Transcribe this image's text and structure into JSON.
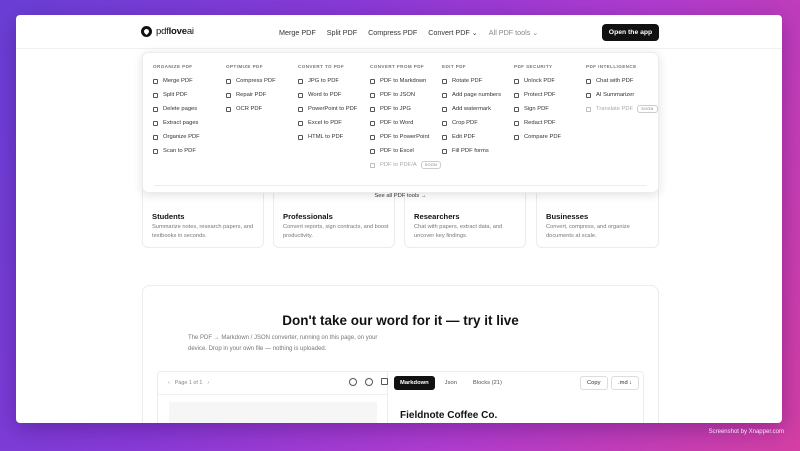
{
  "header": {
    "logo_text": "pdf",
    "logo_bold": "love",
    "logo_suffix": "ai",
    "menu": [
      "Merge PDF",
      "Split PDF",
      "Compress PDF",
      "Convert PDF ⌄",
      "All PDF tools ⌄"
    ],
    "open_app": "Open the app"
  },
  "dropdown": {
    "columns": [
      {
        "title": "ORGANIZE PDF",
        "items": [
          {
            "label": "Merge PDF"
          },
          {
            "label": "Split PDF"
          },
          {
            "label": "Delete pages"
          },
          {
            "label": "Extract pages"
          },
          {
            "label": "Organize PDF"
          },
          {
            "label": "Scan to PDF"
          }
        ]
      },
      {
        "title": "OPTIMIZE PDF",
        "items": [
          {
            "label": "Compress PDF"
          },
          {
            "label": "Repair PDF"
          },
          {
            "label": "OCR PDF"
          }
        ]
      },
      {
        "title": "CONVERT TO PDF",
        "items": [
          {
            "label": "JPG to PDF"
          },
          {
            "label": "Word to PDF"
          },
          {
            "label": "PowerPoint to PDF"
          },
          {
            "label": "Excel to PDF"
          },
          {
            "label": "HTML to PDF"
          }
        ]
      },
      {
        "title": "CONVERT FROM PDF",
        "items": [
          {
            "label": "PDF to Markdown"
          },
          {
            "label": "PDF to JSON"
          },
          {
            "label": "PDF to JPG"
          },
          {
            "label": "PDF to Word"
          },
          {
            "label": "PDF to PowerPoint"
          },
          {
            "label": "PDF to Excel"
          },
          {
            "label": "PDF to PDF/A",
            "soon": "SOON"
          }
        ]
      },
      {
        "title": "EDIT PDF",
        "items": [
          {
            "label": "Rotate PDF"
          },
          {
            "label": "Add page numbers"
          },
          {
            "label": "Add watermark"
          },
          {
            "label": "Crop PDF"
          },
          {
            "label": "Edit PDF"
          },
          {
            "label": "Fill PDF forms"
          }
        ]
      },
      {
        "title": "PDF SECURITY",
        "items": [
          {
            "label": "Unlock PDF"
          },
          {
            "label": "Protect PDF"
          },
          {
            "label": "Sign PDF"
          },
          {
            "label": "Redact PDF"
          },
          {
            "label": "Compare PDF"
          }
        ]
      },
      {
        "title": "PDF INTELLIGENCE",
        "items": [
          {
            "label": "Chat with PDF"
          },
          {
            "label": "AI Summarizer"
          },
          {
            "label": "Translate PDF",
            "soon": "SOON"
          }
        ]
      }
    ],
    "see_all": "See all PDF tools →"
  },
  "cards": [
    {
      "title": "Students",
      "desc": "Summarize notes, research papers, and textbooks in seconds."
    },
    {
      "title": "Professionals",
      "desc": "Convert reports, sign contracts, and boost productivity."
    },
    {
      "title": "Researchers",
      "desc": "Chat with papers, extract data, and uncover key findings."
    },
    {
      "title": "Businesses",
      "desc": "Convert, compress, and organize documents at scale."
    }
  ],
  "demo": {
    "title": "Don't take our word for it — try it live",
    "desc": "The PDF → Markdown / JSON converter, running on this page, on your device. Drop in your own file — nothing is uploaded.",
    "page_indicator": "Page 1 of 1",
    "tabs": [
      "Markdown",
      "Json",
      "Blocks (21)"
    ],
    "copy": "Copy",
    "format": ".md ↓",
    "doc_title": "Fieldnote Coffee Co."
  },
  "watermark": "Screenshot by Xnapper.com"
}
